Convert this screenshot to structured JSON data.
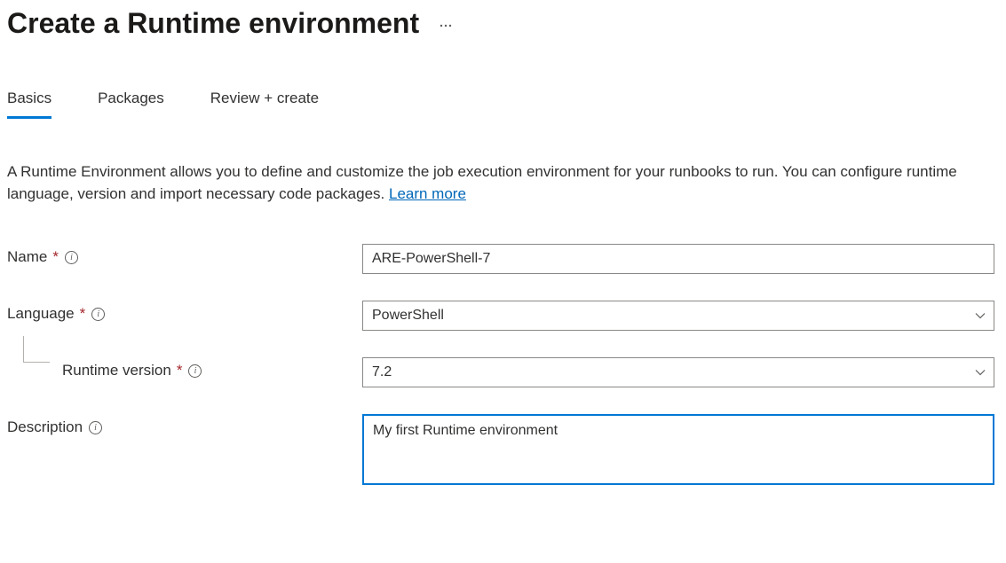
{
  "header": {
    "title": "Create a Runtime environment",
    "more_label": "..."
  },
  "tabs": {
    "items": [
      {
        "label": "Basics",
        "active": true
      },
      {
        "label": "Packages",
        "active": false
      },
      {
        "label": "Review + create",
        "active": false
      }
    ]
  },
  "intro": {
    "text": "A Runtime Environment allows you to define and customize the job execution environment for your runbooks to run. You can configure runtime language, version and import necessary code packages. ",
    "learn_more": "Learn more"
  },
  "form": {
    "name": {
      "label": "Name",
      "required": true,
      "value": "ARE-PowerShell-7"
    },
    "language": {
      "label": "Language",
      "required": true,
      "value": "PowerShell"
    },
    "runtime_version": {
      "label": "Runtime version",
      "required": true,
      "value": "7.2"
    },
    "description": {
      "label": "Description",
      "required": false,
      "value": "My first Runtime environment"
    }
  },
  "glyphs": {
    "info": "i"
  }
}
